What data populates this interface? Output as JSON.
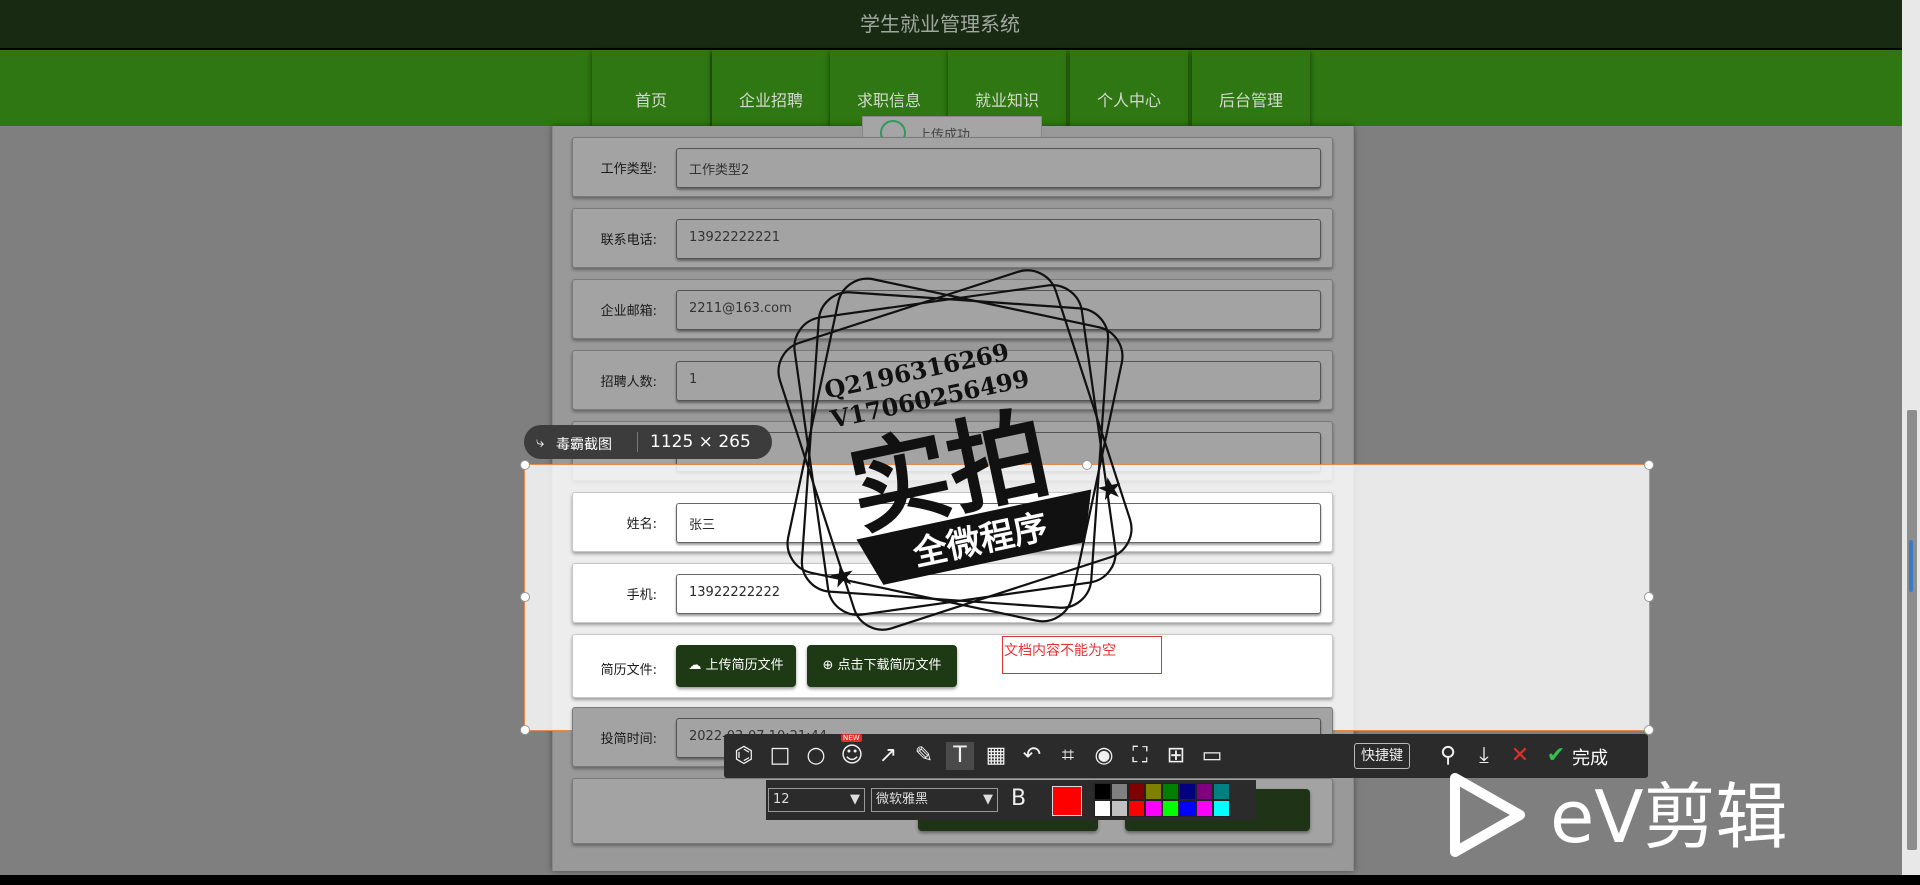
{
  "header": {
    "title": "学生就业管理系统"
  },
  "nav": {
    "items": [
      "首页",
      "企业招聘",
      "求职信息",
      "就业知识",
      "个人中心",
      "后台管理"
    ]
  },
  "toast": {
    "message": "上传成功"
  },
  "form": {
    "fields": [
      {
        "label": "工作类型:",
        "value": "工作类型2"
      },
      {
        "label": "联系电话:",
        "value": "13922222221"
      },
      {
        "label": "企业邮箱:",
        "value": "2211@163.com"
      },
      {
        "label": "招聘人数:",
        "value": "1"
      },
      {
        "label": "",
        "value": ""
      },
      {
        "label": "姓名:",
        "value": "张三"
      },
      {
        "label": "手机:",
        "value": "13922222222"
      }
    ],
    "resume": {
      "label": "简历文件:",
      "upload_button": "上传简历文件",
      "download_button": "点击下载简历文件"
    },
    "submit_time": {
      "label": "投简时间:",
      "value": "2022-03-07 10:21:44"
    }
  },
  "screenshot_tool": {
    "app_name": "毒霸截图",
    "size_text": "1125 × 265",
    "edit_text": "文档内容不能为空",
    "shortcut_label": "快捷键",
    "done_label": "完成",
    "new_badge": "NEW",
    "font_size": "12",
    "font_family": "微软雅黑",
    "bold_label": "B",
    "current_color": "#ff0000",
    "palette": [
      "#000000",
      "#808080",
      "#800000",
      "#808000",
      "#008000",
      "#000080",
      "#800080",
      "#008080",
      "#ffffff",
      "#c0c0c0",
      "#ff0000",
      "#ff00ff",
      "#00ff00",
      "#0000ff",
      "#ff00ff",
      "#00ffff"
    ]
  },
  "stamp": {
    "contact_q": "Q2196316269",
    "contact_v": "V17060256499",
    "main_text": "实拍",
    "banner_text": "全微程序"
  },
  "watermark": {
    "text": "eV剪辑"
  }
}
